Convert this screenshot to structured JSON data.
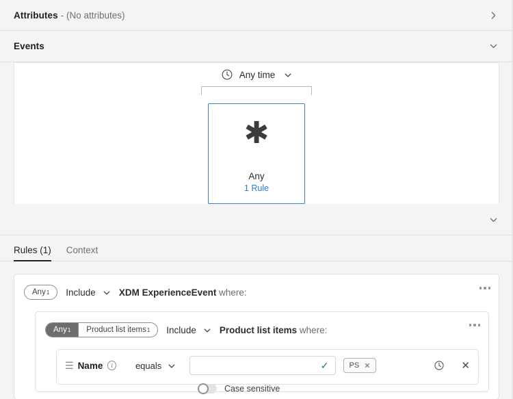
{
  "attributes_section": {
    "title": "Attributes",
    "subtitle": "- (No attributes)",
    "chevron": "chevron-right-icon"
  },
  "events_section": {
    "title": "Events",
    "chevron": "chevron-down-icon",
    "canvas": {
      "time_filter": {
        "icon": "clock-icon",
        "label": "Any time",
        "caret": "chevron-down-icon"
      },
      "node": {
        "glyph": "✱",
        "title": "Any",
        "subtitle": "1 Rule",
        "border_color": "#3b7ad9"
      }
    },
    "footer_chevron": "chevron-down-icon"
  },
  "tabs": [
    {
      "label": "Rules (1)",
      "active": true
    },
    {
      "label": "Context",
      "active": false
    }
  ],
  "rules": {
    "outer": {
      "pill": {
        "primary": "Any",
        "primary_sup": "1"
      },
      "operator": {
        "label": "Include",
        "caret": "chevron-down-icon"
      },
      "statement_bold": "XDM ExperienceEvent",
      "statement_tail": " where:",
      "overflow": "more-options-icon"
    },
    "nested": {
      "pill": {
        "primary": "Any",
        "primary_sup": "1",
        "secondary": "Product list items",
        "secondary_sup": "1"
      },
      "operator": {
        "label": "Include",
        "caret": "chevron-down-icon"
      },
      "statement_bold": "Product list items",
      "statement_tail": " where:",
      "overflow": "more-options-icon"
    },
    "condition": {
      "drag_handle": "drag-handle-icon",
      "field_name": "Name",
      "info_icon": "info-icon",
      "operator": {
        "label": "equals",
        "caret": "chevron-down-icon"
      },
      "value_input": {
        "value": "",
        "placeholder": "",
        "valid_icon": "checkmark-icon"
      },
      "tag": {
        "label": "PS",
        "remove": "close-icon"
      },
      "clock_icon": "clock-icon",
      "close_icon": "close-icon",
      "case_sensitive": {
        "label": "Case sensitive",
        "enabled": false
      }
    }
  },
  "colors": {
    "accent_blue": "#3b7ad9",
    "link_blue": "#2a7bd4",
    "valid_green": "#1a7f4b",
    "pill_dark": "#6d6d6d",
    "panel_bg": "#f4f4f4"
  }
}
